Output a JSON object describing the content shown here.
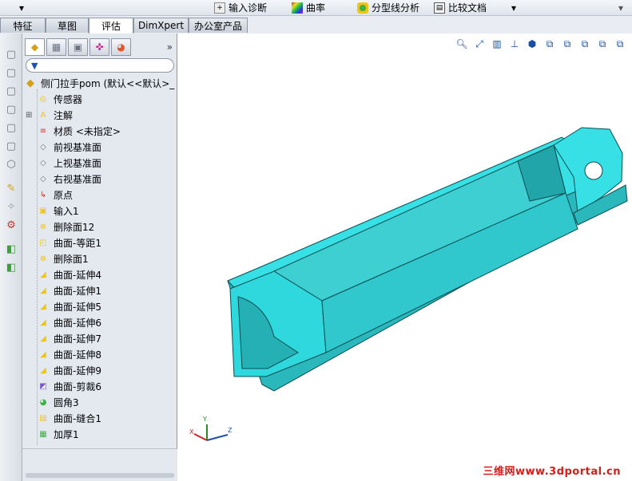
{
  "toolbar": {
    "items": [
      {
        "label": "输入诊断",
        "icon": "import-diagnostics-icon"
      },
      {
        "label": "曲率",
        "icon": "curvature-icon"
      },
      {
        "label": "分型线分析",
        "icon": "parting-line-analysis-icon"
      },
      {
        "label": "比较文档",
        "icon": "compare-documents-icon"
      }
    ]
  },
  "tabs": [
    {
      "label": "特征",
      "active": false
    },
    {
      "label": "草图",
      "active": false
    },
    {
      "label": "评估",
      "active": true
    },
    {
      "label": "DimXpert",
      "active": false
    },
    {
      "label": "办公室产品",
      "active": false
    }
  ],
  "feature_manager": {
    "panel_tabs": [
      {
        "icon": "feature-manager-icon",
        "active": true
      },
      {
        "icon": "property-manager-icon",
        "active": false
      },
      {
        "icon": "configuration-manager-icon",
        "active": false
      },
      {
        "icon": "dimxpert-manager-icon",
        "active": false
      },
      {
        "icon": "display-manager-icon",
        "active": false
      }
    ],
    "more_label": "»",
    "root_label": "侧门拉手pom (默认<<默认>_",
    "items": [
      {
        "label": "传感器",
        "icon": "sensors-icon",
        "color": "#f0c419"
      },
      {
        "label": "注解",
        "icon": "annotations-icon",
        "color": "#f0c419",
        "expandable": true
      },
      {
        "label": "材质 <未指定>",
        "icon": "material-icon",
        "color": "#d13838"
      },
      {
        "label": "前视基准面",
        "icon": "plane-icon",
        "color": "#6a7482"
      },
      {
        "label": "上视基准面",
        "icon": "plane-icon",
        "color": "#6a7482"
      },
      {
        "label": "右视基准面",
        "icon": "plane-icon",
        "color": "#6a7482"
      },
      {
        "label": "原点",
        "icon": "origin-icon",
        "color": "#c0392b"
      },
      {
        "label": "输入1",
        "icon": "imported-body-icon",
        "color": "#f0c419"
      },
      {
        "label": "删除面12",
        "icon": "delete-face-icon",
        "color": "#f0c419"
      },
      {
        "label": "曲面-等距1",
        "icon": "offset-surface-icon",
        "color": "#f0c419"
      },
      {
        "label": "删除面1",
        "icon": "delete-face-icon",
        "color": "#f0c419"
      },
      {
        "label": "曲面-延伸4",
        "icon": "extend-surface-icon",
        "color": "#f0c419"
      },
      {
        "label": "曲面-延伸1",
        "icon": "extend-surface-icon",
        "color": "#f0c419"
      },
      {
        "label": "曲面-延伸5",
        "icon": "extend-surface-icon",
        "color": "#f0c419"
      },
      {
        "label": "曲面-延伸6",
        "icon": "extend-surface-icon",
        "color": "#f0c419"
      },
      {
        "label": "曲面-延伸7",
        "icon": "extend-surface-icon",
        "color": "#f0c419"
      },
      {
        "label": "曲面-延伸8",
        "icon": "extend-surface-icon",
        "color": "#f0c419"
      },
      {
        "label": "曲面-延伸9",
        "icon": "extend-surface-icon",
        "color": "#f0c419"
      },
      {
        "label": "曲面-剪裁6",
        "icon": "trim-surface-icon",
        "color": "#7b5ac8"
      },
      {
        "label": "圆角3",
        "icon": "fillet-icon",
        "color": "#3cb043"
      },
      {
        "label": "曲面-缝合1",
        "icon": "knit-surface-icon",
        "color": "#f0c419"
      },
      {
        "label": "加厚1",
        "icon": "thicken-icon",
        "color": "#3cb043"
      }
    ]
  },
  "viewport": {
    "model_color": "#2fd8dc",
    "watermark": "三维网www.3dportal.cn",
    "triad": {
      "x": "X",
      "y": "Y",
      "z": "Z"
    }
  }
}
